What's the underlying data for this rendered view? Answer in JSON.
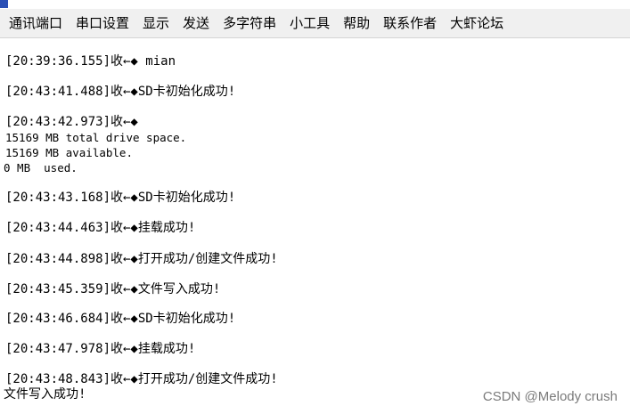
{
  "menu": [
    "通讯端口",
    "串口设置",
    "显示",
    "发送",
    "多字符串",
    "小工具",
    "帮助",
    "联系作者",
    "大虾论坛"
  ],
  "terminal": {
    "lines": [
      "[20:39:36.155]收←◆ mian",
      "[20:43:41.488]收←◆SD卡初始化成功!",
      "[20:43:42.973]收←◆",
      "15169 MB total drive space.",
      "15169 MB available.",
      "0 MB  used.",
      "[20:43:43.168]收←◆SD卡初始化成功!",
      "[20:43:44.463]收←◆挂载成功!",
      "[20:43:44.898]收←◆打开成功/创建文件成功!",
      "[20:43:45.359]收←◆文件写入成功!",
      "[20:43:46.684]收←◆SD卡初始化成功!",
      "[20:43:47.978]收←◆挂载成功!",
      "[20:43:48.843]收←◆打开成功/创建文件成功!",
      "文件写入成功!"
    ]
  },
  "watermark": "CSDN @Melody crush"
}
